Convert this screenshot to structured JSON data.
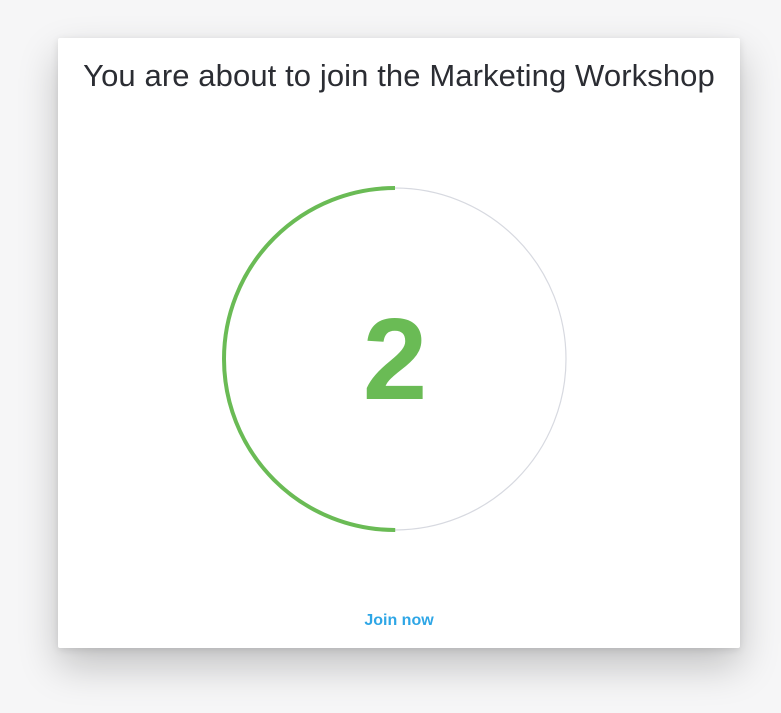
{
  "dialog": {
    "title": "You are about to join the Marketing Workshop",
    "countdown_value": "2",
    "progress_fraction": 0.5,
    "join_label": "Join now"
  },
  "colors": {
    "progress": "#6abb55",
    "track": "#d7d9e0",
    "link": "#2ea6e6",
    "title_text": "#2b2d33"
  }
}
